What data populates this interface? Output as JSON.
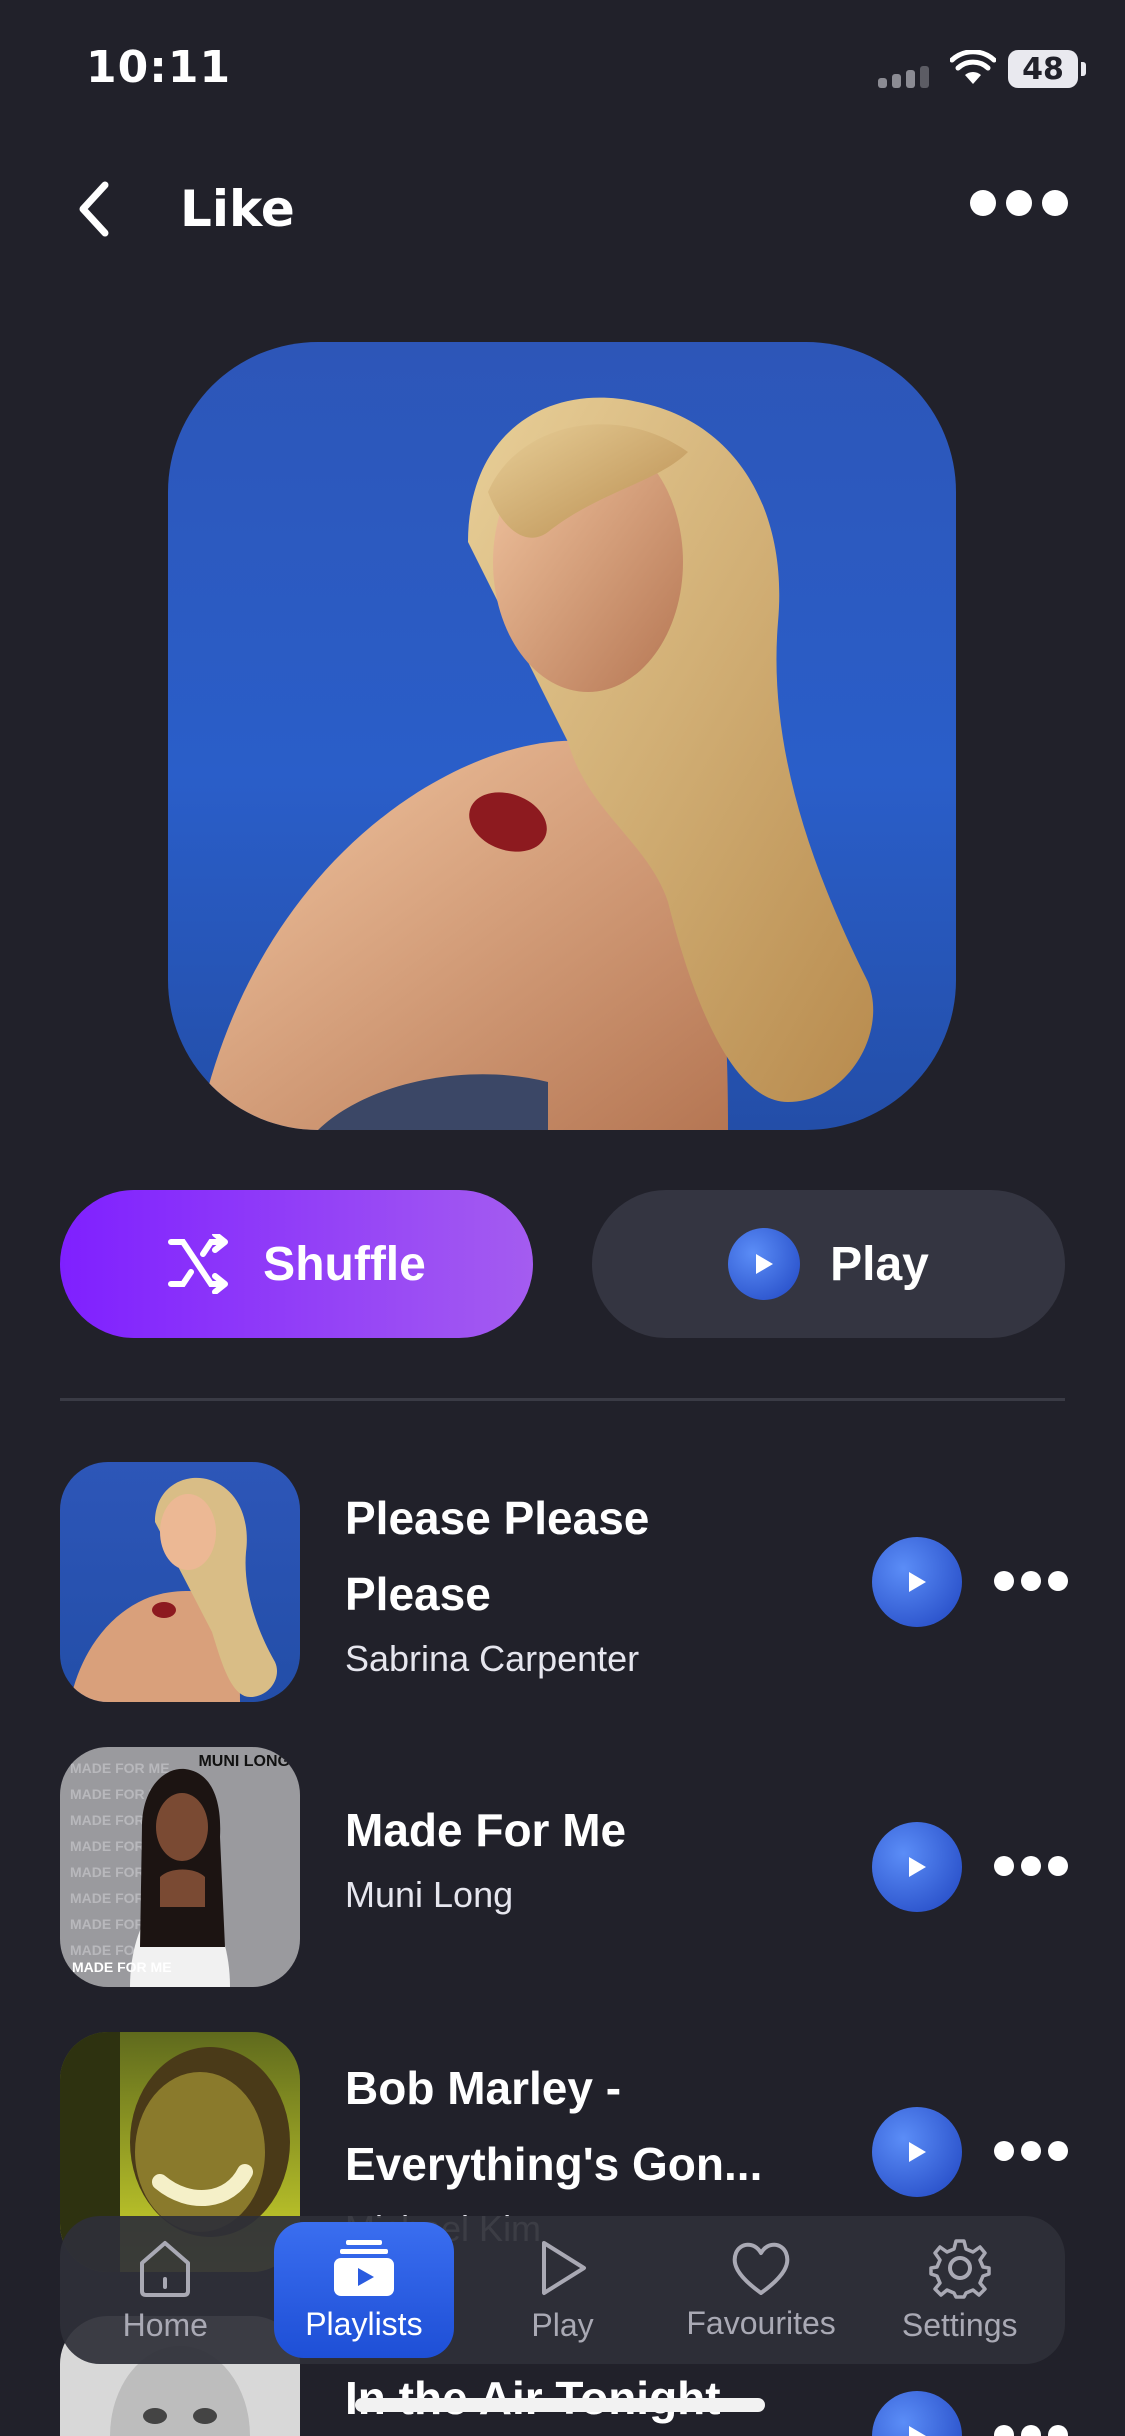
{
  "status_bar": {
    "time": "10:11",
    "battery": "48"
  },
  "header": {
    "title": "Like",
    "back_icon": "chevron-left-icon",
    "more_icon": "more-horizontal-icon"
  },
  "actions": {
    "shuffle_label": "Shuffle",
    "play_label": "Play"
  },
  "songs": [
    {
      "title_line1": "Please Please",
      "title_line2": "Please",
      "artist": "Sabrina Carpenter"
    },
    {
      "title_line1": "Made For Me",
      "title_line2": "",
      "artist": "Muni Long"
    },
    {
      "title_line1": "Bob Marley -",
      "title_line2": "Everything's Gon...",
      "artist": "Michael Kim"
    },
    {
      "title_line1": "In the Air Tonight",
      "title_line2": "",
      "artist": ""
    }
  ],
  "album_text": {
    "made_for_me": "MADE FOR ME",
    "muni_long": "MUNI LONG"
  },
  "tabs": [
    {
      "label": "Home",
      "icon": "home-icon"
    },
    {
      "label": "Playlists",
      "icon": "playlist-icon"
    },
    {
      "label": "Play",
      "icon": "play-icon"
    },
    {
      "label": "Favourites",
      "icon": "heart-icon"
    },
    {
      "label": "Settings",
      "icon": "gear-icon"
    }
  ],
  "colors": {
    "background": "#21212a",
    "accent_purple": "#8a2bff",
    "accent_blue": "#2f5fe0"
  }
}
